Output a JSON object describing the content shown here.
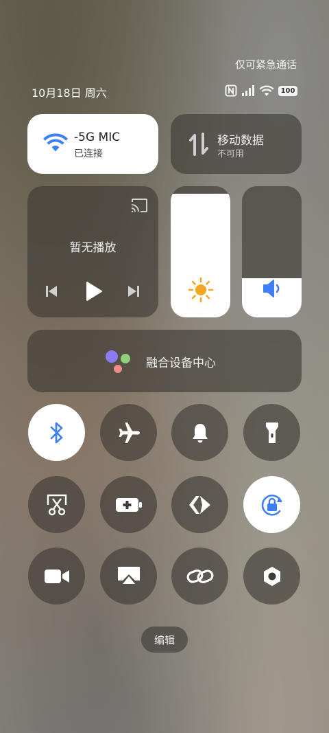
{
  "status": {
    "emergency_only": "仅可紧急通话",
    "date": "10月18日 周六",
    "battery_level": "100"
  },
  "wifi": {
    "name": "-5G    MIC",
    "status": "已连接",
    "accent": "#3d7ff7"
  },
  "mobile_data": {
    "title": "移动数据",
    "status": "不可用"
  },
  "media": {
    "title": "暂无播放"
  },
  "sliders": {
    "brightness_level": 0.94,
    "volume_level": 0.3
  },
  "device_center": {
    "label": "融合设备中心"
  },
  "toggles": [
    {
      "name": "bluetooth",
      "icon": "bluetooth-icon",
      "active": true
    },
    {
      "name": "airplane-mode",
      "icon": "airplane-icon",
      "active": false
    },
    {
      "name": "ring-mode",
      "icon": "bell-icon",
      "active": false
    },
    {
      "name": "flashlight",
      "icon": "flashlight-icon",
      "active": false
    },
    {
      "name": "screenshot",
      "icon": "scissors-icon",
      "active": false
    },
    {
      "name": "battery-saver",
      "icon": "battery-plus-icon",
      "active": false
    },
    {
      "name": "nearby-share",
      "icon": "share-arrows-icon",
      "active": false
    },
    {
      "name": "rotation-lock",
      "icon": "rotation-lock-icon",
      "active": true
    },
    {
      "name": "screen-record",
      "icon": "video-camera-icon",
      "active": false
    },
    {
      "name": "screen-cast",
      "icon": "airplay-icon",
      "active": false
    },
    {
      "name": "link",
      "icon": "link-icon",
      "active": false
    },
    {
      "name": "settings-toggle",
      "icon": "hexagon-nut-icon",
      "active": false
    }
  ],
  "edit": {
    "label": "编辑"
  }
}
